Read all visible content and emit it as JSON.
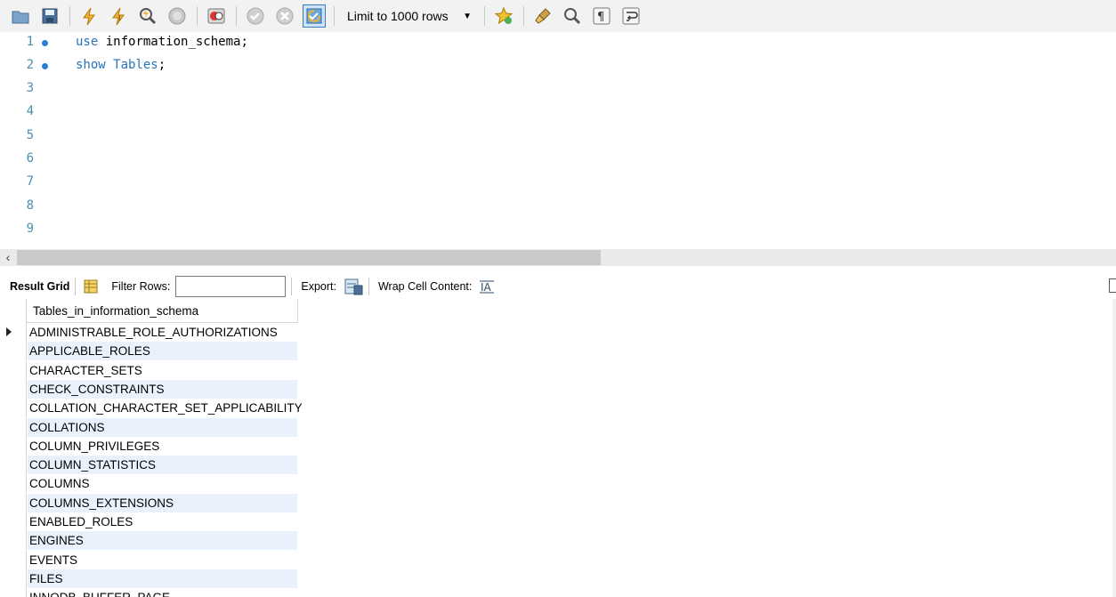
{
  "toolbar": {
    "icons": [
      "open-folder-icon",
      "save-icon",
      "execute-icon",
      "execute-current-icon",
      "explain-icon",
      "stop-icon",
      "toggle-error-icon",
      "commit-icon",
      "rollback-icon",
      "autocommit-icon",
      "beautify-icon",
      "find-icon",
      "invisible-chars-icon",
      "wrap-icon"
    ],
    "limit_label": "Limit to 1000 rows"
  },
  "editor": {
    "lines": [
      {
        "num": "1",
        "keyword": "use",
        "rest": " information_schema;",
        "dot": true
      },
      {
        "num": "2",
        "keyword": "show Tables",
        "rest": ";",
        "dot": true
      },
      {
        "num": "3",
        "keyword": "",
        "rest": "",
        "dot": false
      },
      {
        "num": "4",
        "keyword": "",
        "rest": "",
        "dot": false
      },
      {
        "num": "5",
        "keyword": "",
        "rest": "",
        "dot": false
      },
      {
        "num": "6",
        "keyword": "",
        "rest": "",
        "dot": false
      },
      {
        "num": "7",
        "keyword": "",
        "rest": "",
        "dot": false
      },
      {
        "num": "8",
        "keyword": "",
        "rest": "",
        "dot": false
      },
      {
        "num": "9",
        "keyword": "",
        "rest": "",
        "dot": false
      }
    ]
  },
  "result_toolbar": {
    "result_grid": "Result Grid",
    "filter_rows": "Filter Rows:",
    "filter_value": "",
    "export": "Export:",
    "wrap_cell": "Wrap Cell Content:"
  },
  "grid": {
    "column": "Tables_in_information_schema",
    "rows": [
      "ADMINISTRABLE_ROLE_AUTHORIZATIONS",
      "APPLICABLE_ROLES",
      "CHARACTER_SETS",
      "CHECK_CONSTRAINTS",
      "COLLATION_CHARACTER_SET_APPLICABILITY",
      "COLLATIONS",
      "COLUMN_PRIVILEGES",
      "COLUMN_STATISTICS",
      "COLUMNS",
      "COLUMNS_EXTENSIONS",
      "ENABLED_ROLES",
      "ENGINES",
      "EVENTS",
      "FILES",
      "INNODB_BUFFER_PAGE"
    ]
  }
}
